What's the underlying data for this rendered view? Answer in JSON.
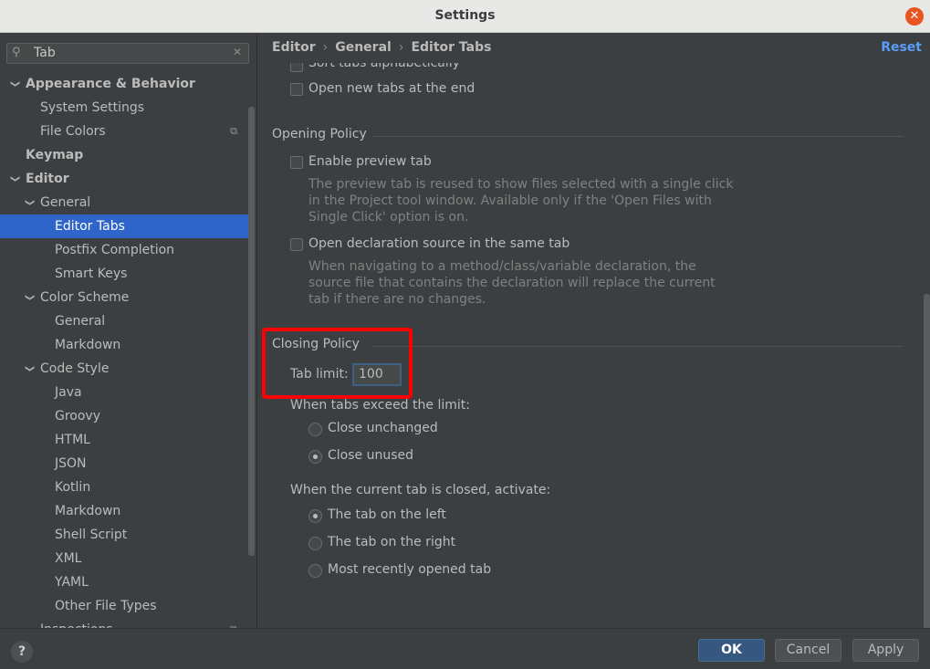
{
  "window": {
    "title": "Settings",
    "close_glyph": "✕"
  },
  "search": {
    "value": "Tab",
    "icon": "search-icon",
    "clear_glyph": "✕"
  },
  "tree": [
    {
      "label": "Appearance & Behavior",
      "indent": 0,
      "expandable": true,
      "bold": true
    },
    {
      "label": "System Settings",
      "indent": 1,
      "expandable": false
    },
    {
      "label": "File Colors",
      "indent": 1,
      "expandable": false,
      "copy": true
    },
    {
      "label": "Keymap",
      "indent": 0,
      "expandable": false,
      "bold": true
    },
    {
      "label": "Editor",
      "indent": 0,
      "expandable": true,
      "bold": true
    },
    {
      "label": "General",
      "indent": 1,
      "expandable": true
    },
    {
      "label": "Editor Tabs",
      "indent": 2,
      "expandable": false,
      "selected": true
    },
    {
      "label": "Postfix Completion",
      "indent": 2,
      "expandable": false
    },
    {
      "label": "Smart Keys",
      "indent": 2,
      "expandable": false
    },
    {
      "label": "Color Scheme",
      "indent": 1,
      "expandable": true
    },
    {
      "label": "General",
      "indent": 2,
      "expandable": false
    },
    {
      "label": "Markdown",
      "indent": 2,
      "expandable": false
    },
    {
      "label": "Code Style",
      "indent": 1,
      "expandable": true
    },
    {
      "label": "Java",
      "indent": 2,
      "expandable": false
    },
    {
      "label": "Groovy",
      "indent": 2,
      "expandable": false
    },
    {
      "label": "HTML",
      "indent": 2,
      "expandable": false
    },
    {
      "label": "JSON",
      "indent": 2,
      "expandable": false
    },
    {
      "label": "Kotlin",
      "indent": 2,
      "expandable": false
    },
    {
      "label": "Markdown",
      "indent": 2,
      "expandable": false
    },
    {
      "label": "Shell Script",
      "indent": 2,
      "expandable": false
    },
    {
      "label": "XML",
      "indent": 2,
      "expandable": false
    },
    {
      "label": "YAML",
      "indent": 2,
      "expandable": false
    },
    {
      "label": "Other File Types",
      "indent": 2,
      "expandable": false
    },
    {
      "label": "Inspections",
      "indent": 1,
      "expandable": false,
      "copy": true
    }
  ],
  "breadcrumb": {
    "items": [
      "Editor",
      "General",
      "Editor Tabs"
    ],
    "separator": "›"
  },
  "reset_label": "Reset",
  "options": {
    "sort_alpha": "Sort tabs alphabetically",
    "open_at_end": "Open new tabs at the end"
  },
  "opening_policy": {
    "title": "Opening Policy",
    "preview_tab": "Enable preview tab",
    "preview_desc": "The preview tab is reused to show files selected with a single click in the Project tool window. Available only if the 'Open Files with Single Click' option is on.",
    "decl_same_tab": "Open declaration source in the same tab",
    "decl_desc": "When navigating to a method/class/variable declaration, the source file that contains the declaration will replace the current tab if there are no changes."
  },
  "closing_policy": {
    "title": "Closing Policy",
    "tab_limit_label": "Tab limit:",
    "tab_limit_value": "100",
    "exceed_label": "When tabs exceed the limit:",
    "close_unchanged": "Close unchanged",
    "close_unused": "Close unused",
    "activate_label": "When the current tab is closed, activate:",
    "left": "The tab on the left",
    "right": "The tab on the right",
    "recent": "Most recently opened tab"
  },
  "footer": {
    "help": "?",
    "ok": "OK",
    "cancel": "Cancel",
    "apply": "Apply"
  },
  "colors": {
    "accent": "#2f65ca",
    "ok_button": "#365880",
    "highlight": "#ff0000",
    "link": "#589df6"
  }
}
